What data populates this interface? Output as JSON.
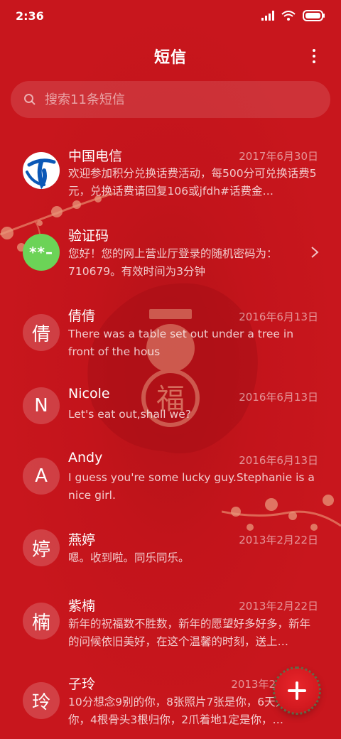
{
  "status_bar": {
    "time": "2:36"
  },
  "header": {
    "title": "短信"
  },
  "search": {
    "placeholder": "搜索11条短信"
  },
  "messages": [
    {
      "name": "中国电信",
      "date": "2017年6月30日",
      "preview": "欢迎参加积分兑换话费活动，每500分可兑换话费5元，兑换话费请回复106或jfdh#话费金…",
      "avatar_icon": "china-telecom-logo"
    },
    {
      "name": "验证码",
      "date": "",
      "preview": "您好！您的网上营业厅登录的随机密码为：710679。有效时间为3分钟",
      "avatar_text": "**–"
    },
    {
      "name": "倩倩",
      "date": "2016年6月13日",
      "preview": "There was a table set out under a tree in front of the hous",
      "avatar_text": "倩"
    },
    {
      "name": "Nicole",
      "date": "2016年6月13日",
      "preview": "Let's eat out,shall we?",
      "avatar_text": "N"
    },
    {
      "name": "Andy",
      "date": "2016年6月13日",
      "preview": "I guess you're some lucky guy.Stephanie is a nice girl.",
      "avatar_text": "A"
    },
    {
      "name": "燕婷",
      "date": "2013年2月22日",
      "preview": "嗯。收到啦。同乐同乐。",
      "avatar_text": "婷"
    },
    {
      "name": "紫楠",
      "date": "2013年2月22日",
      "preview": "新年的祝福数不胜数，新年的愿望好多好多，新年的问候依旧美好，在这个温馨的时刻，送上…",
      "avatar_text": "楠"
    },
    {
      "name": "子玲",
      "date": "2013年2",
      "preview": "10分想念9别的你，8张照片7张是你，6天只像你，4根骨头3根归你，2爪着地1定是你，…",
      "avatar_text": "玲"
    }
  ],
  "colors": {
    "background": "#c8141b",
    "fab": "#d41a20",
    "code_avatar": "#6cd357"
  }
}
